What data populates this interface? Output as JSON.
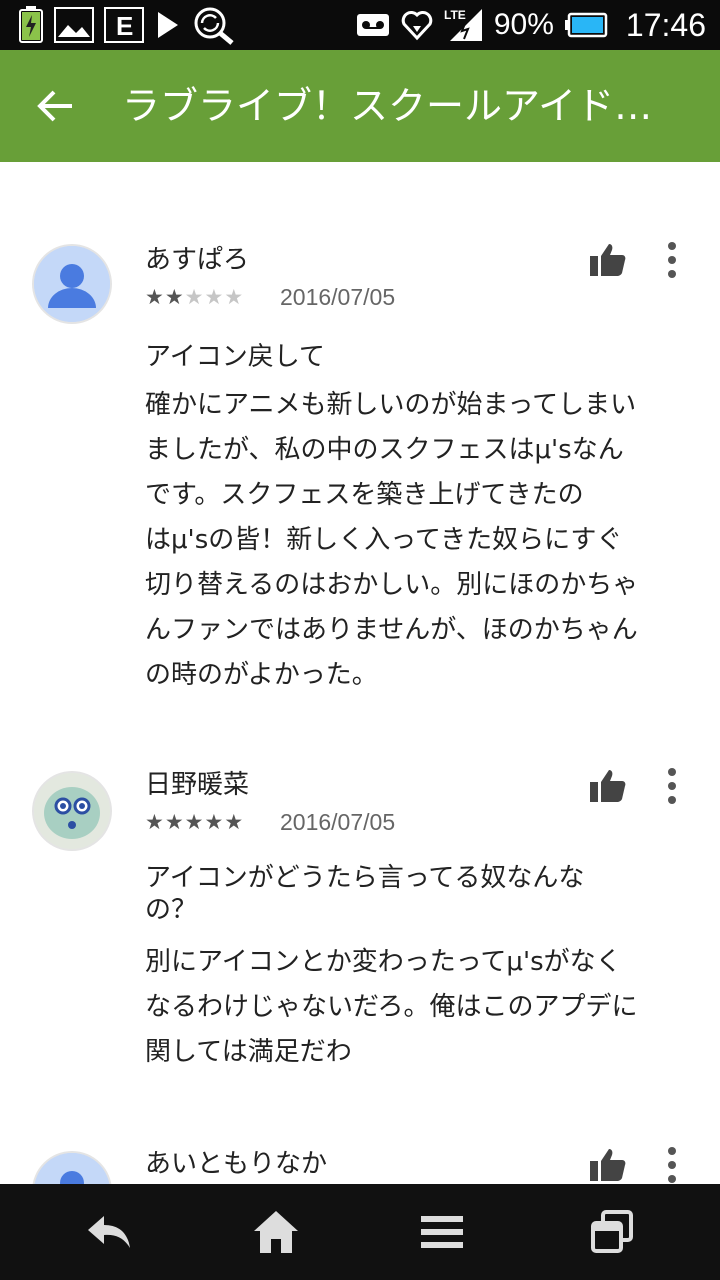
{
  "status_bar": {
    "battery_percent": "90%",
    "time": "17:46",
    "network": "LTE",
    "icons": [
      "battery-charging-icon",
      "image-icon",
      "e-box-icon",
      "play-store-icon",
      "sync-search-icon",
      "voicemail-icon",
      "heart-download-icon",
      "signal-icon",
      "battery-icon"
    ]
  },
  "app_bar": {
    "title": "ラブライブ！スクールアイド…",
    "color": "#689f38"
  },
  "reviews": [
    {
      "author": "あすぱろ",
      "rating": 2,
      "date": "2016/07/05",
      "title": "アイコン戻して",
      "lines": [
        "確かにアニメも新しいのが始まってしまい",
        "ましたが、私の中のスクフェスはμ'sなん",
        "です。スクフェスを築き上げてきたの",
        "はμ'sの皆！新しく入ってきた奴らにすぐ",
        "切り替えるのはおかしい。別にほのかちゃ",
        "んファンではありませんが、ほのかちゃん",
        "の時のがよかった。"
      ]
    },
    {
      "author": "日野暖菜",
      "rating": 5,
      "date": "2016/07/05",
      "title_lines": [
        "アイコンがどうたら言ってる奴なんな",
        "の？"
      ],
      "lines": [
        "別にアイコンとか変わったってμ'sがなく",
        "なるわけじゃないだろ。俺はこのアプデに",
        "関しては満足だわ"
      ]
    },
    {
      "author": "あいともりなか"
    }
  ],
  "nav_bar": {
    "buttons": [
      "back-icon",
      "home-icon",
      "menu-icon",
      "recent-apps-icon"
    ]
  }
}
